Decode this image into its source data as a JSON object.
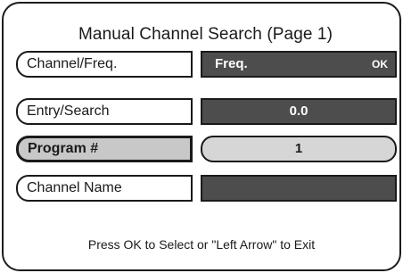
{
  "title": "Manual Channel Search  (Page 1)",
  "rows": [
    {
      "label": "Channel/Freq.",
      "value": "Freq.",
      "ok": "OK"
    },
    {
      "label": "Entry/Search",
      "value": "0.0"
    },
    {
      "label": "Program #",
      "value": "1",
      "selected": true
    },
    {
      "label": "Channel Name",
      "value": ""
    }
  ],
  "footer": "Press OK to Select or \"Left Arrow\" to Exit",
  "colors": {
    "border": "#1a1a1a",
    "value_bg": "#4d4d4d",
    "selected_bg": "#c8c8c8"
  }
}
